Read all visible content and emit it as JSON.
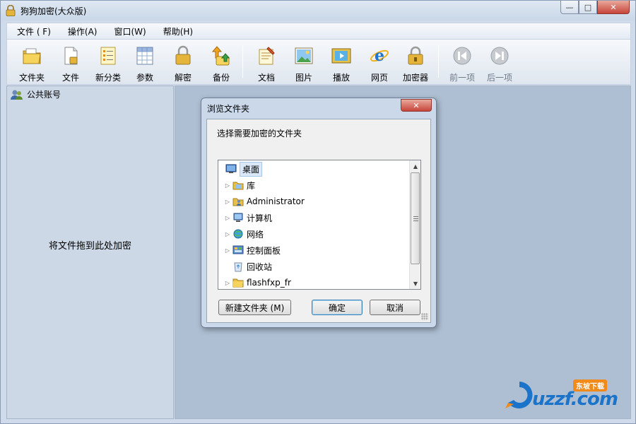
{
  "window": {
    "title": "狗狗加密(大众版)",
    "buttons": {
      "minimize": "—",
      "maximize": "□",
      "close": "✕"
    }
  },
  "menu": [
    {
      "label": "文件 ( F)"
    },
    {
      "label": "操作(A)"
    },
    {
      "label": "窗口(W)"
    },
    {
      "label": "帮助(H)"
    }
  ],
  "toolbar": [
    {
      "label": "文件夹",
      "icon": "folder-icon"
    },
    {
      "label": "文件",
      "icon": "file-icon"
    },
    {
      "label": "新分类",
      "icon": "new-category-icon"
    },
    {
      "label": "参数",
      "icon": "settings-icon"
    },
    {
      "label": "解密",
      "icon": "unlock-icon"
    },
    {
      "label": "备份",
      "icon": "backup-icon"
    },
    {
      "label": "文档",
      "icon": "document-icon"
    },
    {
      "label": "图片",
      "icon": "picture-icon"
    },
    {
      "label": "播放",
      "icon": "play-icon"
    },
    {
      "label": "网页",
      "icon": "ie-icon"
    },
    {
      "label": "加密器",
      "icon": "lock-icon"
    },
    {
      "label": "前一项",
      "icon": "prev-icon"
    },
    {
      "label": "后一项",
      "icon": "next-icon"
    }
  ],
  "left_panel": {
    "account": "公共账号",
    "drop_hint": "将文件拖到此处加密"
  },
  "dialog": {
    "title": "浏览文件夹",
    "description": "选择需要加密的文件夹",
    "tree": [
      {
        "label": "桌面",
        "icon": "desktop-icon",
        "expandable": false,
        "selected": true
      },
      {
        "label": "库",
        "icon": "library-icon",
        "expandable": true
      },
      {
        "label": "Administrator",
        "icon": "user-folder-icon",
        "expandable": true
      },
      {
        "label": "计算机",
        "icon": "computer-icon",
        "expandable": true
      },
      {
        "label": "网络",
        "icon": "network-icon",
        "expandable": true
      },
      {
        "label": "控制面板",
        "icon": "control-panel-icon",
        "expandable": true
      },
      {
        "label": "回收站",
        "icon": "recycle-bin-icon",
        "expandable": false
      },
      {
        "label": "flashfxp_fr",
        "icon": "folder-icon",
        "expandable": true
      }
    ],
    "buttons": {
      "new_folder": "新建文件夹 (M)",
      "ok": "确定",
      "cancel": "取消"
    }
  },
  "watermark": {
    "text": "uzzf.com",
    "badge": "东坡下载"
  }
}
